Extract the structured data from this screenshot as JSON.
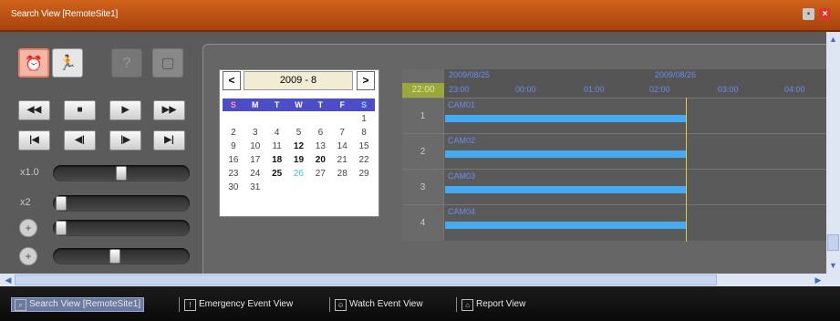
{
  "window": {
    "title": "Search View [RemoteSite1]"
  },
  "modes": [
    {
      "name": "alarm",
      "icon": "alarm-clock-icon",
      "glyph": "⏰",
      "active": true
    },
    {
      "name": "motion",
      "icon": "running-man-icon",
      "glyph": "🏃",
      "active": false
    },
    {
      "name": "disabled-1",
      "icon": "disabled-mode-icon",
      "glyph": "?",
      "active": false
    },
    {
      "name": "disabled-2",
      "icon": "disabled-file-icon",
      "glyph": "▢",
      "active": false
    }
  ],
  "playback": {
    "row1": [
      "◀◀",
      "■",
      "▶",
      "▶▶"
    ],
    "row2": [
      "|◀",
      "◀|",
      "|▶",
      "▶|"
    ]
  },
  "sliders": {
    "speed1": {
      "label": "x1.0",
      "level": 0.5
    },
    "speed2": {
      "label": "x2",
      "level": 0.0
    },
    "slider3": {
      "icon": "plus-circle-icon",
      "level": 0.0
    },
    "slider4": {
      "icon": "plus-circle-icon",
      "level": 0.45
    }
  },
  "calendar": {
    "title": "2009 - 8",
    "prev": "<",
    "next": ">",
    "weekdays": [
      "S",
      "M",
      "T",
      "W",
      "T",
      "F",
      "S"
    ],
    "days": [
      "",
      "",
      "",
      "",
      "",
      "",
      "1",
      "2",
      "3",
      "4",
      "5",
      "6",
      "7",
      "8",
      "9",
      "10",
      "11",
      "12",
      "13",
      "14",
      "15",
      "16",
      "17",
      "18",
      "19",
      "20",
      "21",
      "22",
      "23",
      "24",
      "25",
      "26",
      "27",
      "28",
      "29",
      "30",
      "31"
    ],
    "bold_days": [
      "12",
      "18",
      "19",
      "20",
      "25"
    ],
    "today": "26"
  },
  "timeline": {
    "head_label": "22:00",
    "dates": [
      "2009/08/25",
      "2009/08/26"
    ],
    "ticks": [
      "22:00",
      "23:00",
      "00:00",
      "01:00",
      "02:00",
      "03:00",
      "04:00"
    ],
    "rows": [
      {
        "id": "1",
        "name": "CAM01"
      },
      {
        "id": "2",
        "name": "CAM02"
      },
      {
        "id": "3",
        "name": "CAM03"
      },
      {
        "id": "4",
        "name": "CAM04"
      }
    ]
  },
  "taskbar": {
    "items": [
      {
        "label": "Search View [RemoteSite1]",
        "icon": "search-view-icon",
        "active": true
      },
      {
        "label": "Emergency Event View",
        "icon": "emergency-icon",
        "active": false
      },
      {
        "label": "Watch Event View",
        "icon": "watch-event-icon",
        "active": false
      },
      {
        "label": "Report View",
        "icon": "report-icon",
        "active": false
      }
    ]
  },
  "colors": {
    "titlebar": "#c0561a",
    "accent": "#45aaf0",
    "cursor": "#d9d240"
  }
}
